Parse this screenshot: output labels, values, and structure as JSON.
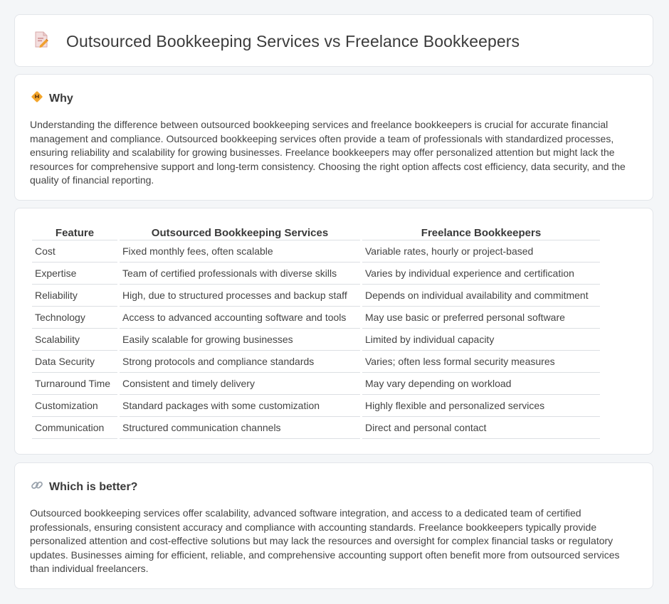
{
  "header": {
    "title": "Outsourced Bookkeeping Services vs Freelance Bookkeepers"
  },
  "why": {
    "title": "Why",
    "text": "Understanding the difference between outsourced bookkeeping services and freelance bookkeepers is crucial for accurate financial management and compliance. Outsourced bookkeeping services often provide a team of professionals with standardized processes, ensuring reliability and scalability for growing businesses. Freelance bookkeepers may offer personalized attention but might lack the resources for comprehensive support and long-term consistency. Choosing the right option affects cost efficiency, data security, and the quality of financial reporting."
  },
  "comparison": {
    "headers": [
      "Feature",
      "Outsourced Bookkeeping Services",
      "Freelance Bookkeepers"
    ],
    "rows": [
      [
        "Cost",
        "Fixed monthly fees, often scalable",
        "Variable rates, hourly or project-based"
      ],
      [
        "Expertise",
        "Team of certified professionals with diverse skills",
        "Varies by individual experience and certification"
      ],
      [
        "Reliability",
        "High, due to structured processes and backup staff",
        "Depends on individual availability and commitment"
      ],
      [
        "Technology",
        "Access to advanced accounting software and tools",
        "May use basic or preferred personal software"
      ],
      [
        "Scalability",
        "Easily scalable for growing businesses",
        "Limited by individual capacity"
      ],
      [
        "Data Security",
        "Strong protocols and compliance standards",
        "Varies; often less formal security measures"
      ],
      [
        "Turnaround Time",
        "Consistent and timely delivery",
        "May vary depending on workload"
      ],
      [
        "Customization",
        "Standard packages with some customization",
        "Highly flexible and personalized services"
      ],
      [
        "Communication",
        "Structured communication channels",
        "Direct and personal contact"
      ]
    ]
  },
  "better": {
    "title": "Which is better?",
    "text": "Outsourced bookkeeping services offer scalability, advanced software integration, and access to a dedicated team of certified professionals, ensuring consistent accuracy and compliance with accounting standards. Freelance bookkeepers typically provide personalized attention and cost-effective solutions but may lack the resources and oversight for complex financial tasks or regulatory updates. Businesses aiming for efficient, reliable, and comprehensive accounting support often benefit more from outsourced services than individual freelancers."
  },
  "icons": {
    "header": "document-pencil-icon",
    "why": "diamond-warning-icon",
    "better": "link-icon"
  },
  "colors": {
    "accent": "#f0a030",
    "title_text": "#3b3b3b",
    "body_text": "#444444",
    "card_border": "#e3e6ea",
    "page_background": "#f4f6f8"
  }
}
